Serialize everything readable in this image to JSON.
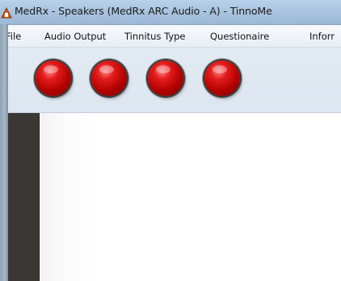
{
  "window": {
    "title": "MedRx - Speakers (MedRx ARC Audio - A) - TinnoMe",
    "app_icon": "medrx-app-icon"
  },
  "menubar": {
    "items": [
      {
        "label": "File"
      },
      {
        "label": "Audio Output"
      },
      {
        "label": "Tinnitus Type"
      },
      {
        "label": "Questionaire"
      },
      {
        "label": "Inforr"
      }
    ]
  },
  "toolbar": {
    "indicators": [
      {
        "name": "red-indicator-1",
        "color": "#d40000"
      },
      {
        "name": "red-indicator-2",
        "color": "#d40000"
      },
      {
        "name": "red-indicator-3",
        "color": "#d40000"
      },
      {
        "name": "red-indicator-4",
        "color": "#d40000"
      }
    ]
  },
  "colors": {
    "titlebar": "#a9c3df",
    "menubar": "#f0f4f9",
    "toolbar": "#dde6f0",
    "side_panel": "#3b3734",
    "content": "#ffffff"
  }
}
